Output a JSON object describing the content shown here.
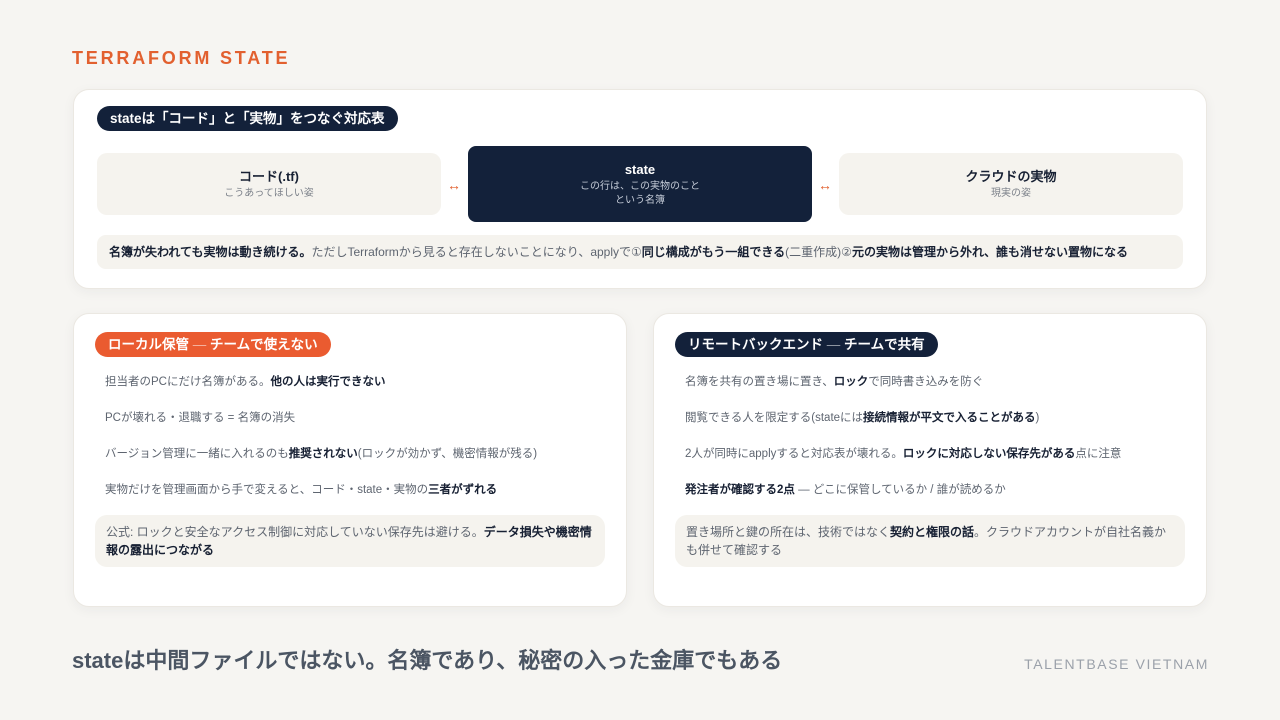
{
  "colors": {
    "background": "#f6f5f2",
    "accent": "#e2602f",
    "badge_orange": "#ea5b30",
    "navy": "#13213a",
    "panel": "#f5f3ee",
    "text_muted": "#5e6570",
    "text_strong": "#172033",
    "headline": "#4b5563",
    "brand": "#9ba1aa"
  },
  "header": {
    "eyebrow": "TERRAFORM STATE"
  },
  "mapping": {
    "badge": "stateは「コード」と「実物」をつなぐ対応表",
    "code_box": {
      "title": "コード(.tf)",
      "subtitle": "こうあってほしい姿"
    },
    "arrow_left": "↔",
    "state_box": {
      "title": "state",
      "subtitle_lines": [
        "この行は、この実物のこと",
        "という名簿"
      ]
    },
    "arrow_right": "↔",
    "cloud_box": {
      "title": "クラウドの実物",
      "subtitle": "現実の姿"
    },
    "note": [
      {
        "text": "名簿が失われても実物は動き続ける。",
        "emphasis": true
      },
      {
        "text": "ただしTerraformから見ると存在しないことになり、applyで①",
        "emphasis": false
      },
      {
        "text": "同じ構成がもう一組できる",
        "emphasis": true
      },
      {
        "text": "(二重作成)②",
        "emphasis": false
      },
      {
        "text": "元の実物は管理から外れ、誰も消せない置物になる",
        "emphasis": true
      }
    ]
  },
  "local": {
    "badge": {
      "label": "ローカル保管",
      "separator": " — ",
      "sub": "チームで使えない"
    },
    "items": [
      [
        {
          "text": "担当者のPCにだけ名簿がある。",
          "emphasis": false
        },
        {
          "text": "他の人は実行できない",
          "emphasis": true
        }
      ],
      [
        {
          "text": "PCが壊れる・退職する = 名簿の消失",
          "emphasis": false
        }
      ],
      [
        {
          "text": "バージョン管理に一緒に入れるのも",
          "emphasis": false
        },
        {
          "text": "推奨されない",
          "emphasis": true
        },
        {
          "text": "(ロックが効かず、機密情報が残る)",
          "emphasis": false
        }
      ],
      [
        {
          "text": "実物だけを管理画面から手で変えると、コード・state・実物の",
          "emphasis": false
        },
        {
          "text": "三者がずれる",
          "emphasis": true
        }
      ]
    ],
    "note": [
      {
        "text": "公式: ロックと安全なアクセス制御に対応していない保存先は避ける。",
        "emphasis": false
      },
      {
        "text": "データ損失や機密情報の露出につながる",
        "emphasis": true
      }
    ]
  },
  "remote": {
    "badge": {
      "label": "リモートバックエンド",
      "separator": " — ",
      "sub": "チームで共有"
    },
    "items": [
      [
        {
          "text": "名簿を共有の置き場に置き、",
          "emphasis": false
        },
        {
          "text": "ロック",
          "emphasis": true
        },
        {
          "text": "で同時書き込みを防ぐ",
          "emphasis": false
        }
      ],
      [
        {
          "text": "閲覧できる人を限定する(stateには",
          "emphasis": false
        },
        {
          "text": "接続情報が平文で入ることがある",
          "emphasis": true
        },
        {
          "text": ")",
          "emphasis": false
        }
      ],
      [
        {
          "text": "2人が同時にapplyすると対応表が壊れる。",
          "emphasis": false
        },
        {
          "text": "ロックに対応しない保存先がある",
          "emphasis": true
        },
        {
          "text": "点に注意",
          "emphasis": false
        }
      ],
      [
        {
          "text": "発注者が確認する2点",
          "emphasis": true
        },
        {
          "text": " — どこに保管しているか / 誰が読めるか",
          "emphasis": false
        }
      ]
    ],
    "note": [
      {
        "text": "置き場所と鍵の所在は、技術ではなく",
        "emphasis": false
      },
      {
        "text": "契約と権限の話",
        "emphasis": true
      },
      {
        "text": "。クラウドアカウントが自社名義かも併せて確認する",
        "emphasis": false
      }
    ]
  },
  "footer": {
    "headline": "stateは中間ファイルではない。名簿であり、秘密の入った金庫でもある",
    "brand": "TALENTBASE VIETNAM"
  }
}
